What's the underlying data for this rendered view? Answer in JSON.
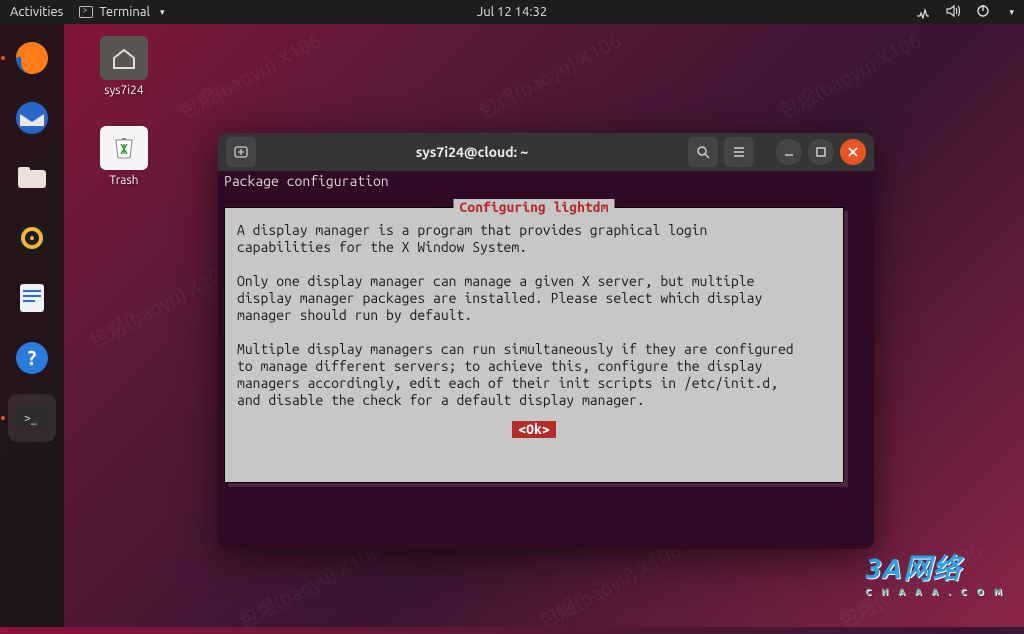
{
  "topbar": {
    "activities": "Activities",
    "appmenu": "Terminal",
    "clock": "Jul 12  14:32"
  },
  "desktop": {
    "home_label": "sys7i24",
    "trash_label": "Trash"
  },
  "dock": {
    "items": [
      {
        "name": "firefox",
        "running": true
      },
      {
        "name": "thunderbird",
        "running": false
      },
      {
        "name": "files",
        "running": false
      },
      {
        "name": "rhythmbox",
        "running": false
      },
      {
        "name": "libreoffice-writer",
        "running": false
      },
      {
        "name": "help",
        "running": false
      },
      {
        "name": "terminal",
        "running": true,
        "active": true
      }
    ]
  },
  "window": {
    "title": "sys7i24@cloud: ~"
  },
  "terminal": {
    "header": "Package configuration",
    "dialog_title": "Configuring lightdm",
    "dialog_body": "A display manager is a program that provides graphical login\ncapabilities for the X Window System.\n\nOnly one display manager can manage a given X server, but multiple\ndisplay manager packages are installed. Please select which display\nmanager should run by default.\n\nMultiple display managers can run simultaneously if they are configured\nto manage different servers; to achieve this, configure the display\nmanagers accordingly, edit each of their init scripts in /etc/init.d,\nand disable the check for a default display manager.",
    "ok_label": "<Ok>"
  },
  "watermark": {
    "text": "包煜(baoyu)\nX106"
  },
  "logo": {
    "brand": "3A网络",
    "sub": "C N A A A . C O M"
  }
}
